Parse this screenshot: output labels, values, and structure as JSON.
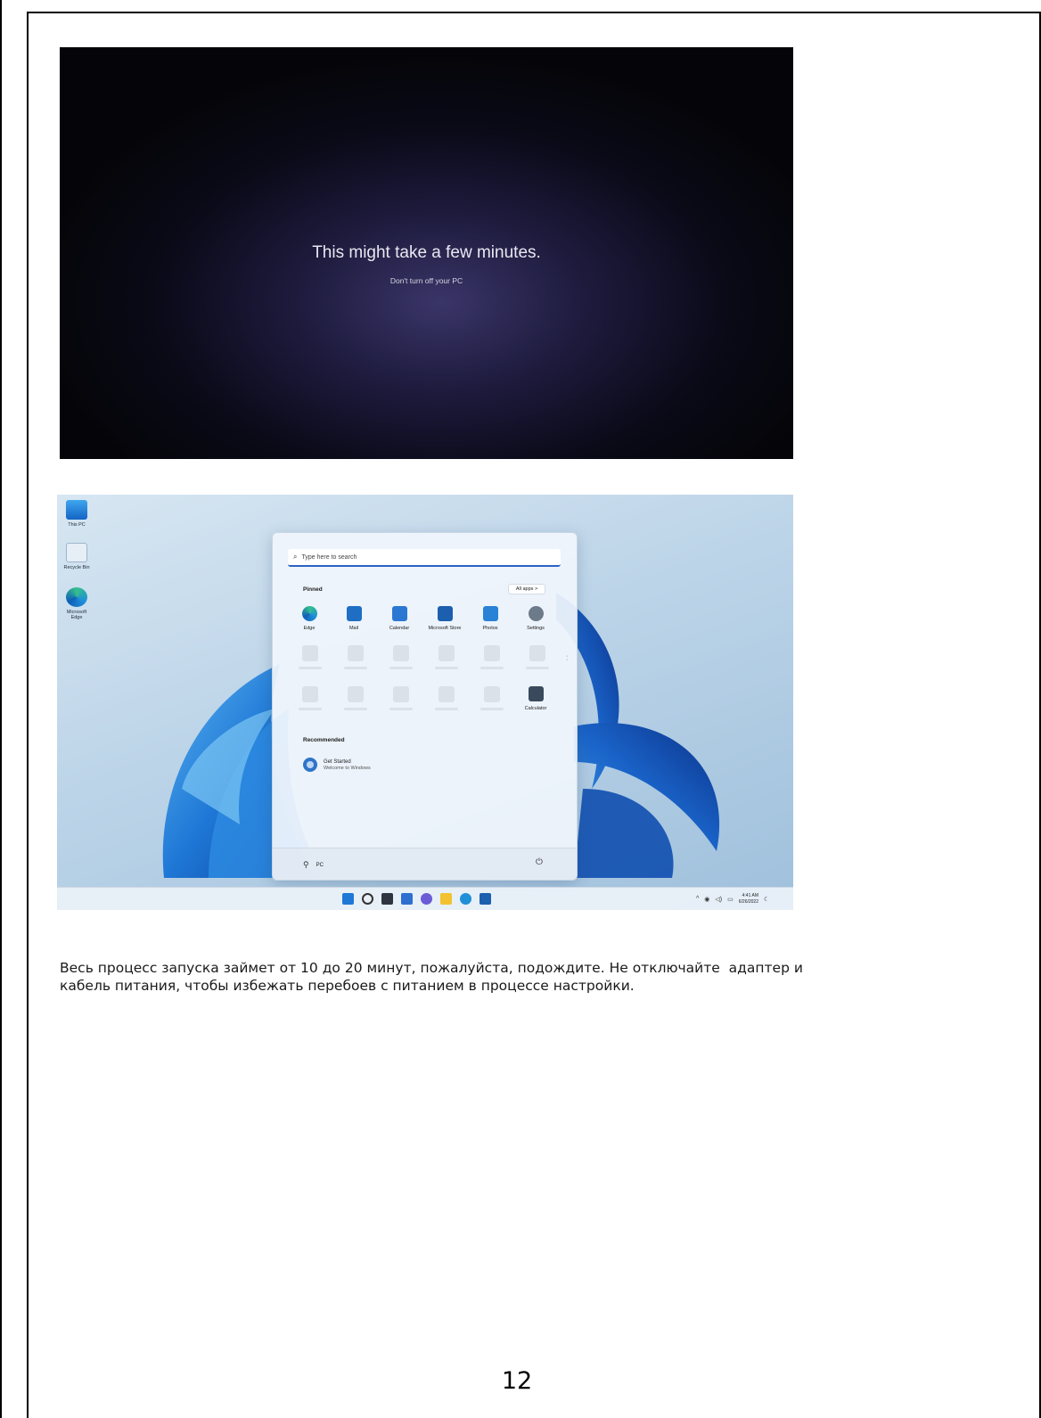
{
  "setup_screen": {
    "title": "This might take a few minutes.",
    "subtitle": "Don't turn off your PC"
  },
  "desktop": {
    "icons": [
      {
        "label": "This PC",
        "icon": "this-pc-icon"
      },
      {
        "label": "Recycle Bin",
        "icon": "recycle-bin-icon"
      },
      {
        "label": "Microsoft Edge",
        "icon": "edge-icon"
      }
    ],
    "start_menu": {
      "search_placeholder": "Type here to search",
      "pinned_title": "Pinned",
      "all_apps_label": "All apps  >",
      "pinned_apps": [
        {
          "label": "Edge",
          "icon": "edge-icon",
          "color": "#1f8fd8"
        },
        {
          "label": "Mail",
          "icon": "mail-icon",
          "color": "#1e6fc4"
        },
        {
          "label": "Calendar",
          "icon": "calendar-icon",
          "color": "#2b78d3"
        },
        {
          "label": "Microsoft Store",
          "icon": "store-icon",
          "color": "#1c5fae"
        },
        {
          "label": "Photos",
          "icon": "photos-icon",
          "color": "#2a82d6"
        },
        {
          "label": "Settings",
          "icon": "settings-icon",
          "color": "#6d7a8a"
        }
      ],
      "calculator_label": "Calculator",
      "recommended_title": "Recommended",
      "recommended_item": {
        "title": "Get Started",
        "subtitle": "Welcome to Windows"
      },
      "user_name": "PC"
    },
    "tray": {
      "time": "4:41 AM",
      "date": "6/26/2022"
    }
  },
  "body_text": "Весь процесс запуска займет от 10 до 20 минут, пожалуйста, подождите. Не отключайте  адаптер и\nкабель питания, чтобы избежать перебоев с питанием в процессе настройки.",
  "page_number": "12"
}
